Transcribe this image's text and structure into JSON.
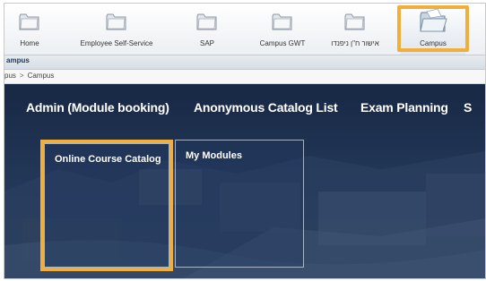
{
  "topnav": {
    "items": [
      {
        "label": "Home",
        "icon": "folder-icon"
      },
      {
        "label": "Employee Self-Service",
        "icon": "folder-icon"
      },
      {
        "label": "SAP",
        "icon": "folder-icon"
      },
      {
        "label": "Campus GWT",
        "icon": "folder-icon"
      },
      {
        "label": "אישור ח\"ן ניפנדו",
        "icon": "folder-icon"
      },
      {
        "label": "Campus",
        "icon": "open-folder-icon"
      }
    ],
    "active": "Campus"
  },
  "header": {
    "page_title": "ampus",
    "breadcrumb": [
      "pus",
      "Campus"
    ]
  },
  "tabs": [
    {
      "label": "Admin (Module booking)"
    },
    {
      "label": "Anonymous Catalog List"
    },
    {
      "label": "Exam Planning"
    },
    {
      "label": "S"
    }
  ],
  "tiles": [
    {
      "label": "Online Course Catalog"
    },
    {
      "label": "My Modules"
    }
  ],
  "colors": {
    "highlight": "#f2ae3a",
    "content_bg": "#1d2f4e"
  }
}
